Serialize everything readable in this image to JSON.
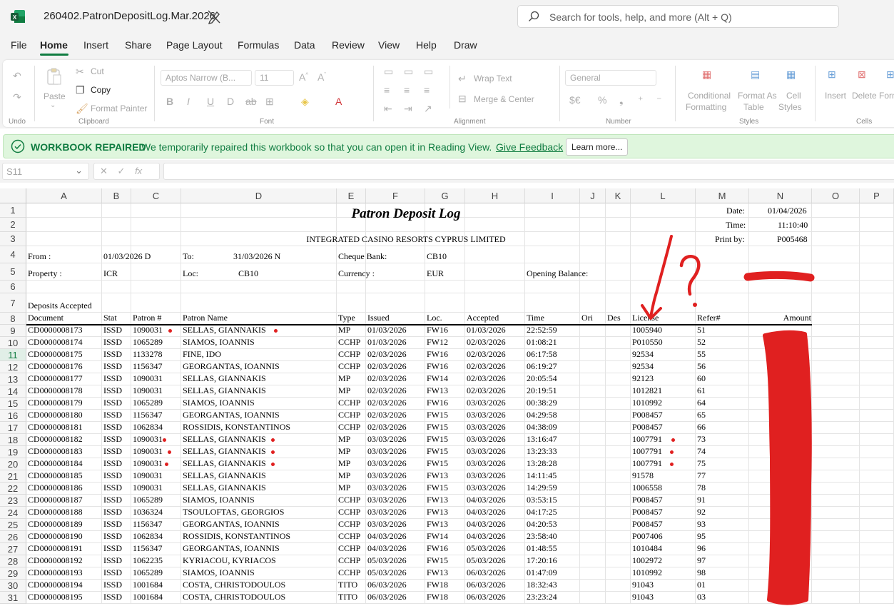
{
  "titlebar": {
    "doc_title": "260402.PatronDepositLog.Mar.2026"
  },
  "search": {
    "placeholder": "Search for tools, help, and more (Alt + Q)"
  },
  "menu": [
    "File",
    "Home",
    "Insert",
    "Share",
    "Page Layout",
    "Formulas",
    "Data",
    "Review",
    "View",
    "Help",
    "Draw"
  ],
  "ribbon": {
    "clipboard": {
      "paste": "Paste",
      "cut": "Cut",
      "copy": "Copy",
      "format_painter": "Format Painter",
      "label": "Clipboard"
    },
    "undo_label": "Undo",
    "font": {
      "name": "Aptos Narrow (B...",
      "size": "11",
      "label": "Font"
    },
    "alignment": {
      "wrap": "Wrap Text",
      "merge": "Merge & Center",
      "label": "Alignment"
    },
    "number": {
      "format": "General",
      "label": "Number"
    },
    "styles": {
      "conditional": "Conditional",
      "conditional2": "Formatting",
      "format_as": "Format As",
      "format_as2": "Table",
      "cell": "Cell",
      "cell2": "Styles",
      "label": "Styles"
    },
    "cells": {
      "insert": "Insert",
      "delete": "Delete",
      "format": "Form",
      "label": "Cells"
    }
  },
  "banner": {
    "title": "WORKBOOK REPAIRED",
    "message": "We temporarily repaired this workbook so that you can open it in Reading View.",
    "feedback": "Give Feedback",
    "learn_more": "Learn more..."
  },
  "formula_bar": {
    "name_box": "S11",
    "fx": "fx"
  },
  "columns": [
    "A",
    "B",
    "C",
    "D",
    "E",
    "F",
    "G",
    "H",
    "I",
    "J",
    "K",
    "L",
    "M",
    "N",
    "O",
    "P"
  ],
  "rows": [
    "1",
    "2",
    "3",
    "4",
    "5",
    "6",
    "7",
    "8",
    "9",
    "10",
    "11",
    "12",
    "13",
    "14",
    "15",
    "16",
    "17",
    "18",
    "19",
    "20",
    "21",
    "22",
    "23",
    "24",
    "25",
    "26",
    "27",
    "28",
    "29",
    "30",
    "31"
  ],
  "report": {
    "title": "Patron Deposit Log",
    "company": "INTEGRATED CASINO RESORTS CYPRUS LIMITED",
    "date_label": "Date:",
    "date": "01/04/2026",
    "time_label": "Time:",
    "time": "11:10:40",
    "print_label": "Print by:",
    "print_by": "P005468",
    "from_label": "From :",
    "from": "01/03/2026 D",
    "to_label": "To:",
    "to": "31/03/2026 N",
    "cheque_label": "Cheque Bank:",
    "cheque": "CB10",
    "property_label": "Property :",
    "property": "ICR",
    "loc_label": "Loc:",
    "loc": "CB10",
    "currency_label": "Currency :",
    "currency": "EUR",
    "opening_label": "Opening Balance:",
    "section": "Deposits Accepted"
  },
  "table_headers": [
    "Document",
    "Stat",
    "Patron #",
    "Patron Name",
    "Type",
    "Issued",
    "Loc.",
    "Accepted",
    "Time",
    "Ori",
    "Des",
    "License",
    "Refer#",
    "Amount"
  ],
  "table_rows": [
    [
      "CD0000008173",
      "ISSD",
      "1090031",
      "SELLAS, GIANNAKIS",
      "MP",
      "01/03/2026",
      "FW16",
      "01/03/2026",
      "22:52:59",
      "1005940",
      "51"
    ],
    [
      "CD0000008174",
      "ISSD",
      "1065289",
      "SIAMOS, IOANNIS",
      "CCHP",
      "01/03/2026",
      "FW12",
      "02/03/2026",
      "01:08:21",
      "P010550",
      "52"
    ],
    [
      "CD0000008175",
      "ISSD",
      "1133278",
      "FINE, IDO",
      "CCHP",
      "02/03/2026",
      "FW16",
      "02/03/2026",
      "06:17:58",
      "92534",
      "55"
    ],
    [
      "CD0000008176",
      "ISSD",
      "1156347",
      "GEORGANTAS, IOANNIS",
      "CCHP",
      "02/03/2026",
      "FW16",
      "02/03/2026",
      "06:19:27",
      "92534",
      "56"
    ],
    [
      "CD0000008177",
      "ISSD",
      "1090031",
      "SELLAS, GIANNAKIS",
      "MP",
      "02/03/2026",
      "FW14",
      "02/03/2026",
      "20:05:54",
      "92123",
      "60"
    ],
    [
      "CD0000008178",
      "ISSD",
      "1090031",
      "SELLAS, GIANNAKIS",
      "MP",
      "02/03/2026",
      "FW13",
      "02/03/2026",
      "20:19:51",
      "1012821",
      "61"
    ],
    [
      "CD0000008179",
      "ISSD",
      "1065289",
      "SIAMOS, IOANNIS",
      "CCHP",
      "02/03/2026",
      "FW16",
      "03/03/2026",
      "00:38:29",
      "1010992",
      "64"
    ],
    [
      "CD0000008180",
      "ISSD",
      "1156347",
      "GEORGANTAS, IOANNIS",
      "CCHP",
      "02/03/2026",
      "FW15",
      "03/03/2026",
      "04:29:58",
      "P008457",
      "65"
    ],
    [
      "CD0000008181",
      "ISSD",
      "1062834",
      "ROSSIDIS, KONSTANTINOS",
      "CCHP",
      "02/03/2026",
      "FW15",
      "03/03/2026",
      "04:38:09",
      "P008457",
      "66"
    ],
    [
      "CD0000008182",
      "ISSD",
      "1090031",
      "SELLAS, GIANNAKIS",
      "MP",
      "03/03/2026",
      "FW15",
      "03/03/2026",
      "13:16:47",
      "1007791",
      "73"
    ],
    [
      "CD0000008183",
      "ISSD",
      "1090031",
      "SELLAS, GIANNAKIS",
      "MP",
      "03/03/2026",
      "FW15",
      "03/03/2026",
      "13:23:33",
      "1007791",
      "74"
    ],
    [
      "CD0000008184",
      "ISSD",
      "1090031",
      "SELLAS, GIANNAKIS",
      "MP",
      "03/03/2026",
      "FW15",
      "03/03/2026",
      "13:28:28",
      "1007791",
      "75"
    ],
    [
      "CD0000008185",
      "ISSD",
      "1090031",
      "SELLAS, GIANNAKIS",
      "MP",
      "03/03/2026",
      "FW13",
      "03/03/2026",
      "14:11:45",
      "91578",
      "77"
    ],
    [
      "CD0000008186",
      "ISSD",
      "1090031",
      "SELLAS, GIANNAKIS",
      "MP",
      "03/03/2026",
      "FW15",
      "03/03/2026",
      "14:29:59",
      "1006558",
      "78"
    ],
    [
      "CD0000008187",
      "ISSD",
      "1065289",
      "SIAMOS, IOANNIS",
      "CCHP",
      "03/03/2026",
      "FW13",
      "04/03/2026",
      "03:53:15",
      "P008457",
      "91"
    ],
    [
      "CD0000008188",
      "ISSD",
      "1036324",
      "TSOULOFTAS, GEORGIOS",
      "CCHP",
      "03/03/2026",
      "FW13",
      "04/03/2026",
      "04:17:25",
      "P008457",
      "92"
    ],
    [
      "CD0000008189",
      "ISSD",
      "1156347",
      "GEORGANTAS, IOANNIS",
      "CCHP",
      "03/03/2026",
      "FW13",
      "04/03/2026",
      "04:20:53",
      "P008457",
      "93"
    ],
    [
      "CD0000008190",
      "ISSD",
      "1062834",
      "ROSSIDIS, KONSTANTINOS",
      "CCHP",
      "04/03/2026",
      "FW14",
      "04/03/2026",
      "23:58:40",
      "P007406",
      "95"
    ],
    [
      "CD0000008191",
      "ISSD",
      "1156347",
      "GEORGANTAS, IOANNIS",
      "CCHP",
      "04/03/2026",
      "FW16",
      "05/03/2026",
      "01:48:55",
      "1010484",
      "96"
    ],
    [
      "CD0000008192",
      "ISSD",
      "1062235",
      "KYRIACOU, KYRIACOS",
      "CCHP",
      "05/03/2026",
      "FW15",
      "05/03/2026",
      "17:20:16",
      "1002972",
      "97"
    ],
    [
      "CD0000008193",
      "ISSD",
      "1065289",
      "SIAMOS, IOANNIS",
      "CCHP",
      "05/03/2026",
      "FW13",
      "06/03/2026",
      "01:47:09",
      "1010992",
      "98"
    ],
    [
      "CD0000008194",
      "ISSD",
      "1001684",
      "COSTA, CHRISTODOULOS",
      "TITO",
      "06/03/2026",
      "FW18",
      "06/03/2026",
      "18:32:43",
      "91043",
      "01"
    ],
    [
      "CD0000008195",
      "ISSD",
      "1001684",
      "COSTA, CHRISTODOULOS",
      "TITO",
      "06/03/2026",
      "FW18",
      "06/03/2026",
      "23:23:24",
      "91043",
      "03"
    ]
  ],
  "annotation": {
    "mark": "?",
    "color": "#e02020"
  },
  "colors": {
    "brand": "#107c41",
    "banner_bg": "#dff6dd",
    "annotation_red": "#e02020"
  }
}
